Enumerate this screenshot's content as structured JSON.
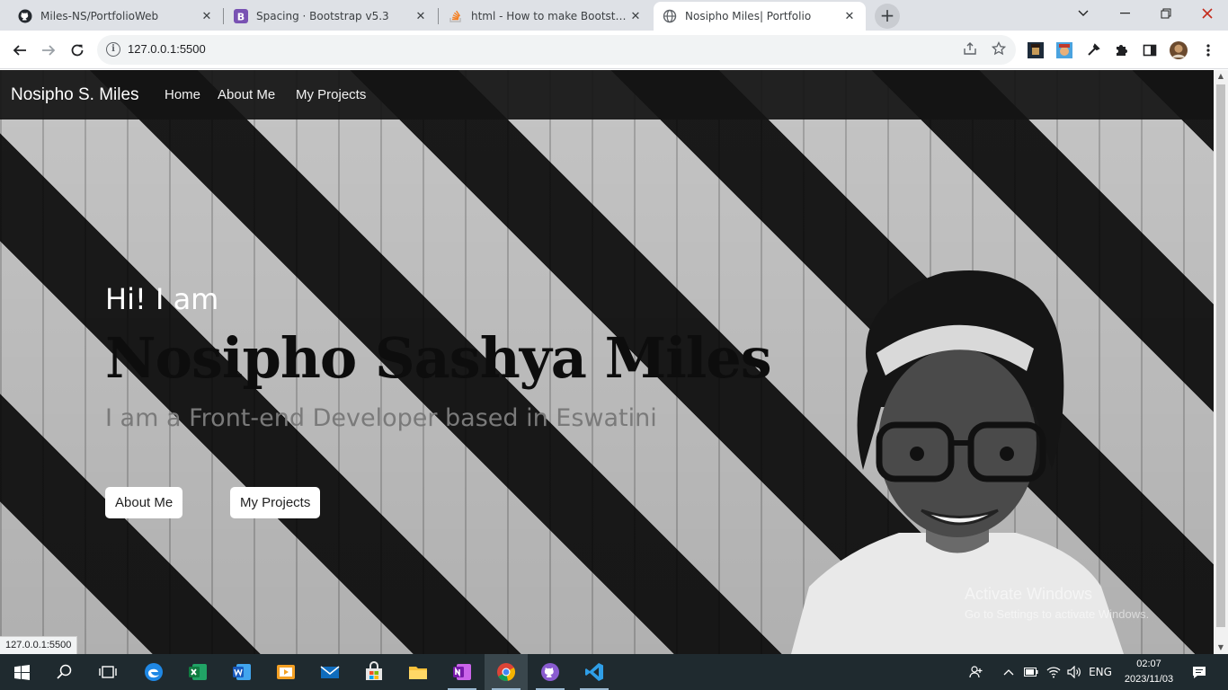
{
  "browser": {
    "tabs": [
      {
        "title": "Miles-NS/PortfolioWeb",
        "icon": "github-icon"
      },
      {
        "title": "Spacing · Bootstrap v5.3",
        "icon": "bootstrap-icon"
      },
      {
        "title": "html - How to make Bootstrap c",
        "icon": "stackoverflow-icon"
      },
      {
        "title": "Nosipho Miles| Portfolio",
        "icon": "globe-icon",
        "active": true
      }
    ],
    "new_tab_glyph": "+",
    "close_glyph": "✕",
    "url": "127.0.0.1:5500",
    "status_url": "127.0.0.1:5500"
  },
  "site": {
    "brand": "Nosipho S. Miles",
    "nav": [
      "Home",
      "About Me",
      "My Projects"
    ],
    "hero": {
      "greeting": "Hi! I am",
      "name": "Nosipho Sashya Miles",
      "tagline": "I am a Front-end Developer based in Eswatini",
      "buttons": [
        "About Me",
        "My Projects"
      ]
    }
  },
  "watermark": {
    "line1": "Activate Windows",
    "line2": "Go to Settings to activate Windows."
  },
  "taskbar": {
    "apps": [
      "start-icon",
      "search-icon",
      "task-view-icon",
      "edge-icon",
      "excel-icon",
      "word-icon",
      "media-player-icon",
      "mail-icon",
      "store-icon",
      "file-explorer-icon",
      "onenote-icon",
      "chrome-icon",
      "github-desktop-icon",
      "vscode-icon"
    ],
    "language": "ENG",
    "time": "02:07",
    "date": "2023/11/03"
  },
  "colors": {
    "navbar": "#141414",
    "tabstrip": "#dee1e6",
    "taskbar": "#1f2a2f"
  }
}
